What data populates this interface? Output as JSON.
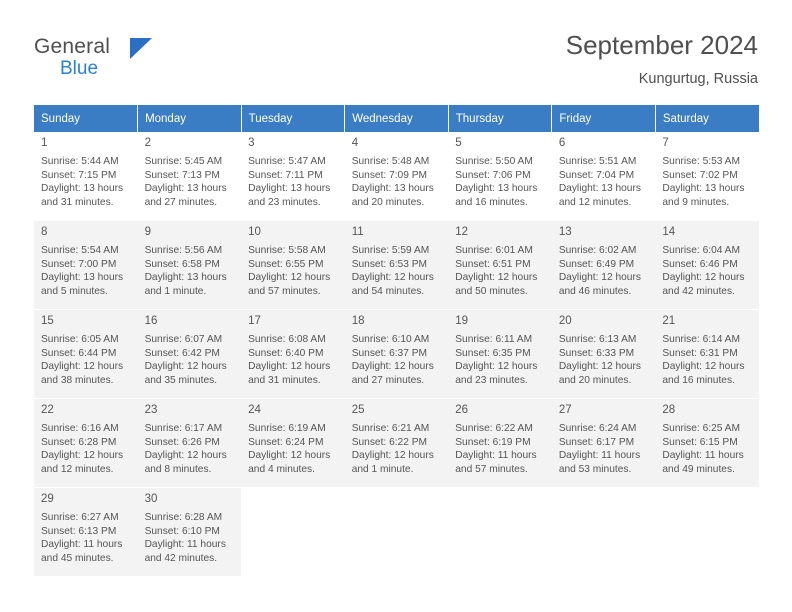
{
  "header": {
    "logo_general": "General",
    "logo_blue": "Blue",
    "month_title": "September 2024",
    "location": "Kungurtug, Russia",
    "accent_color": "#3b7dc4"
  },
  "calendar": {
    "weekday_headers": [
      "Sunday",
      "Monday",
      "Tuesday",
      "Wednesday",
      "Thursday",
      "Friday",
      "Saturday"
    ],
    "weeks": [
      [
        {
          "day": "1",
          "sunrise": "Sunrise: 5:44 AM",
          "sunset": "Sunset: 7:15 PM",
          "daylight1": "Daylight: 13 hours",
          "daylight2": "and 31 minutes."
        },
        {
          "day": "2",
          "sunrise": "Sunrise: 5:45 AM",
          "sunset": "Sunset: 7:13 PM",
          "daylight1": "Daylight: 13 hours",
          "daylight2": "and 27 minutes."
        },
        {
          "day": "3",
          "sunrise": "Sunrise: 5:47 AM",
          "sunset": "Sunset: 7:11 PM",
          "daylight1": "Daylight: 13 hours",
          "daylight2": "and 23 minutes."
        },
        {
          "day": "4",
          "sunrise": "Sunrise: 5:48 AM",
          "sunset": "Sunset: 7:09 PM",
          "daylight1": "Daylight: 13 hours",
          "daylight2": "and 20 minutes."
        },
        {
          "day": "5",
          "sunrise": "Sunrise: 5:50 AM",
          "sunset": "Sunset: 7:06 PM",
          "daylight1": "Daylight: 13 hours",
          "daylight2": "and 16 minutes."
        },
        {
          "day": "6",
          "sunrise": "Sunrise: 5:51 AM",
          "sunset": "Sunset: 7:04 PM",
          "daylight1": "Daylight: 13 hours",
          "daylight2": "and 12 minutes."
        },
        {
          "day": "7",
          "sunrise": "Sunrise: 5:53 AM",
          "sunset": "Sunset: 7:02 PM",
          "daylight1": "Daylight: 13 hours",
          "daylight2": "and 9 minutes."
        }
      ],
      [
        {
          "day": "8",
          "sunrise": "Sunrise: 5:54 AM",
          "sunset": "Sunset: 7:00 PM",
          "daylight1": "Daylight: 13 hours",
          "daylight2": "and 5 minutes."
        },
        {
          "day": "9",
          "sunrise": "Sunrise: 5:56 AM",
          "sunset": "Sunset: 6:58 PM",
          "daylight1": "Daylight: 13 hours",
          "daylight2": "and 1 minute."
        },
        {
          "day": "10",
          "sunrise": "Sunrise: 5:58 AM",
          "sunset": "Sunset: 6:55 PM",
          "daylight1": "Daylight: 12 hours",
          "daylight2": "and 57 minutes."
        },
        {
          "day": "11",
          "sunrise": "Sunrise: 5:59 AM",
          "sunset": "Sunset: 6:53 PM",
          "daylight1": "Daylight: 12 hours",
          "daylight2": "and 54 minutes."
        },
        {
          "day": "12",
          "sunrise": "Sunrise: 6:01 AM",
          "sunset": "Sunset: 6:51 PM",
          "daylight1": "Daylight: 12 hours",
          "daylight2": "and 50 minutes."
        },
        {
          "day": "13",
          "sunrise": "Sunrise: 6:02 AM",
          "sunset": "Sunset: 6:49 PM",
          "daylight1": "Daylight: 12 hours",
          "daylight2": "and 46 minutes."
        },
        {
          "day": "14",
          "sunrise": "Sunrise: 6:04 AM",
          "sunset": "Sunset: 6:46 PM",
          "daylight1": "Daylight: 12 hours",
          "daylight2": "and 42 minutes."
        }
      ],
      [
        {
          "day": "15",
          "sunrise": "Sunrise: 6:05 AM",
          "sunset": "Sunset: 6:44 PM",
          "daylight1": "Daylight: 12 hours",
          "daylight2": "and 38 minutes."
        },
        {
          "day": "16",
          "sunrise": "Sunrise: 6:07 AM",
          "sunset": "Sunset: 6:42 PM",
          "daylight1": "Daylight: 12 hours",
          "daylight2": "and 35 minutes."
        },
        {
          "day": "17",
          "sunrise": "Sunrise: 6:08 AM",
          "sunset": "Sunset: 6:40 PM",
          "daylight1": "Daylight: 12 hours",
          "daylight2": "and 31 minutes."
        },
        {
          "day": "18",
          "sunrise": "Sunrise: 6:10 AM",
          "sunset": "Sunset: 6:37 PM",
          "daylight1": "Daylight: 12 hours",
          "daylight2": "and 27 minutes."
        },
        {
          "day": "19",
          "sunrise": "Sunrise: 6:11 AM",
          "sunset": "Sunset: 6:35 PM",
          "daylight1": "Daylight: 12 hours",
          "daylight2": "and 23 minutes."
        },
        {
          "day": "20",
          "sunrise": "Sunrise: 6:13 AM",
          "sunset": "Sunset: 6:33 PM",
          "daylight1": "Daylight: 12 hours",
          "daylight2": "and 20 minutes."
        },
        {
          "day": "21",
          "sunrise": "Sunrise: 6:14 AM",
          "sunset": "Sunset: 6:31 PM",
          "daylight1": "Daylight: 12 hours",
          "daylight2": "and 16 minutes."
        }
      ],
      [
        {
          "day": "22",
          "sunrise": "Sunrise: 6:16 AM",
          "sunset": "Sunset: 6:28 PM",
          "daylight1": "Daylight: 12 hours",
          "daylight2": "and 12 minutes."
        },
        {
          "day": "23",
          "sunrise": "Sunrise: 6:17 AM",
          "sunset": "Sunset: 6:26 PM",
          "daylight1": "Daylight: 12 hours",
          "daylight2": "and 8 minutes."
        },
        {
          "day": "24",
          "sunrise": "Sunrise: 6:19 AM",
          "sunset": "Sunset: 6:24 PM",
          "daylight1": "Daylight: 12 hours",
          "daylight2": "and 4 minutes."
        },
        {
          "day": "25",
          "sunrise": "Sunrise: 6:21 AM",
          "sunset": "Sunset: 6:22 PM",
          "daylight1": "Daylight: 12 hours",
          "daylight2": "and 1 minute."
        },
        {
          "day": "26",
          "sunrise": "Sunrise: 6:22 AM",
          "sunset": "Sunset: 6:19 PM",
          "daylight1": "Daylight: 11 hours",
          "daylight2": "and 57 minutes."
        },
        {
          "day": "27",
          "sunrise": "Sunrise: 6:24 AM",
          "sunset": "Sunset: 6:17 PM",
          "daylight1": "Daylight: 11 hours",
          "daylight2": "and 53 minutes."
        },
        {
          "day": "28",
          "sunrise": "Sunrise: 6:25 AM",
          "sunset": "Sunset: 6:15 PM",
          "daylight1": "Daylight: 11 hours",
          "daylight2": "and 49 minutes."
        }
      ],
      [
        {
          "day": "29",
          "sunrise": "Sunrise: 6:27 AM",
          "sunset": "Sunset: 6:13 PM",
          "daylight1": "Daylight: 11 hours",
          "daylight2": "and 45 minutes."
        },
        {
          "day": "30",
          "sunrise": "Sunrise: 6:28 AM",
          "sunset": "Sunset: 6:10 PM",
          "daylight1": "Daylight: 11 hours",
          "daylight2": "and 42 minutes."
        },
        {
          "day": "",
          "sunrise": "",
          "sunset": "",
          "daylight1": "",
          "daylight2": ""
        },
        {
          "day": "",
          "sunrise": "",
          "sunset": "",
          "daylight1": "",
          "daylight2": ""
        },
        {
          "day": "",
          "sunrise": "",
          "sunset": "",
          "daylight1": "",
          "daylight2": ""
        },
        {
          "day": "",
          "sunrise": "",
          "sunset": "",
          "daylight1": "",
          "daylight2": ""
        },
        {
          "day": "",
          "sunrise": "",
          "sunset": "",
          "daylight1": "",
          "daylight2": ""
        }
      ]
    ]
  }
}
